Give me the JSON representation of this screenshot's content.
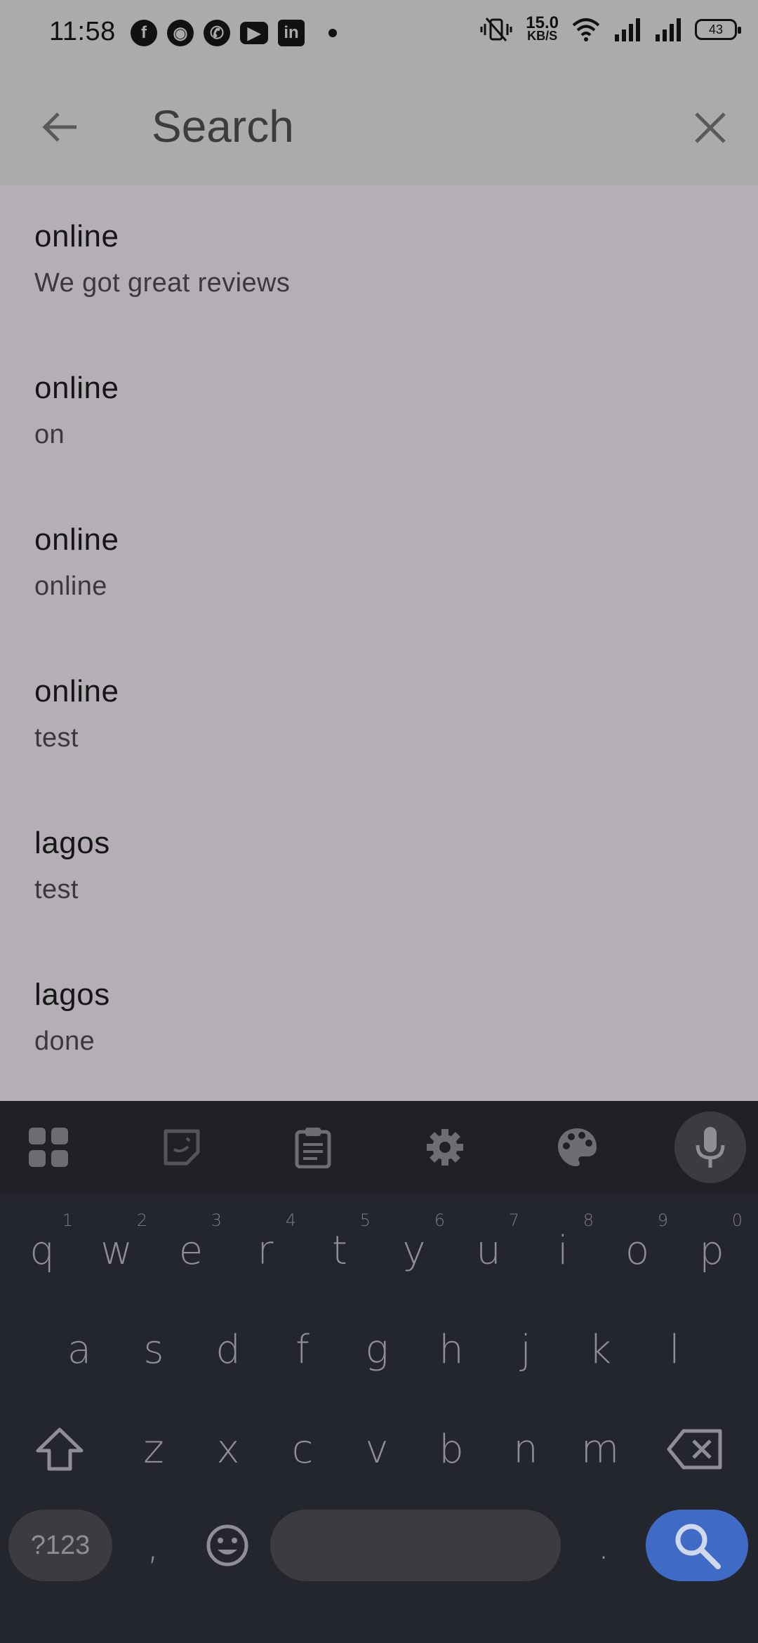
{
  "status_bar": {
    "time": "11:58",
    "apps": [
      {
        "icon": "facebook-icon",
        "glyph": "f"
      },
      {
        "icon": "snapchat-icon",
        "glyph": "◉"
      },
      {
        "icon": "whatsapp-icon",
        "glyph": "✆"
      },
      {
        "icon": "youtube-icon",
        "glyph": "▶"
      },
      {
        "icon": "linkedin-icon",
        "glyph": "in"
      }
    ],
    "speed_value": "15.0",
    "speed_unit": "KB/S",
    "battery": "43"
  },
  "app_bar": {
    "search_placeholder": "Search",
    "search_value": ""
  },
  "results": [
    {
      "title": "online",
      "subtitle": "We got great reviews"
    },
    {
      "title": "online",
      "subtitle": "on"
    },
    {
      "title": "online",
      "subtitle": "online"
    },
    {
      "title": "online",
      "subtitle": "test"
    },
    {
      "title": "lagos",
      "subtitle": "test"
    },
    {
      "title": "lagos",
      "subtitle": "done"
    }
  ],
  "keyboard": {
    "row1": [
      {
        "key": "q",
        "hint": "1"
      },
      {
        "key": "w",
        "hint": "2"
      },
      {
        "key": "e",
        "hint": "3"
      },
      {
        "key": "r",
        "hint": "4"
      },
      {
        "key": "t",
        "hint": "5"
      },
      {
        "key": "y",
        "hint": "6"
      },
      {
        "key": "u",
        "hint": "7"
      },
      {
        "key": "i",
        "hint": "8"
      },
      {
        "key": "o",
        "hint": "9"
      },
      {
        "key": "p",
        "hint": "0"
      }
    ],
    "row2": [
      "a",
      "s",
      "d",
      "f",
      "g",
      "h",
      "j",
      "k",
      "l"
    ],
    "row3": [
      "z",
      "x",
      "c",
      "v",
      "b",
      "n",
      "m"
    ],
    "symbols_label": "?123",
    "comma": ",",
    "period": "."
  },
  "colors": {
    "overlay": "#b3afb4",
    "keyboard_bg": "#23262c",
    "accent": "#3f6bc7"
  }
}
